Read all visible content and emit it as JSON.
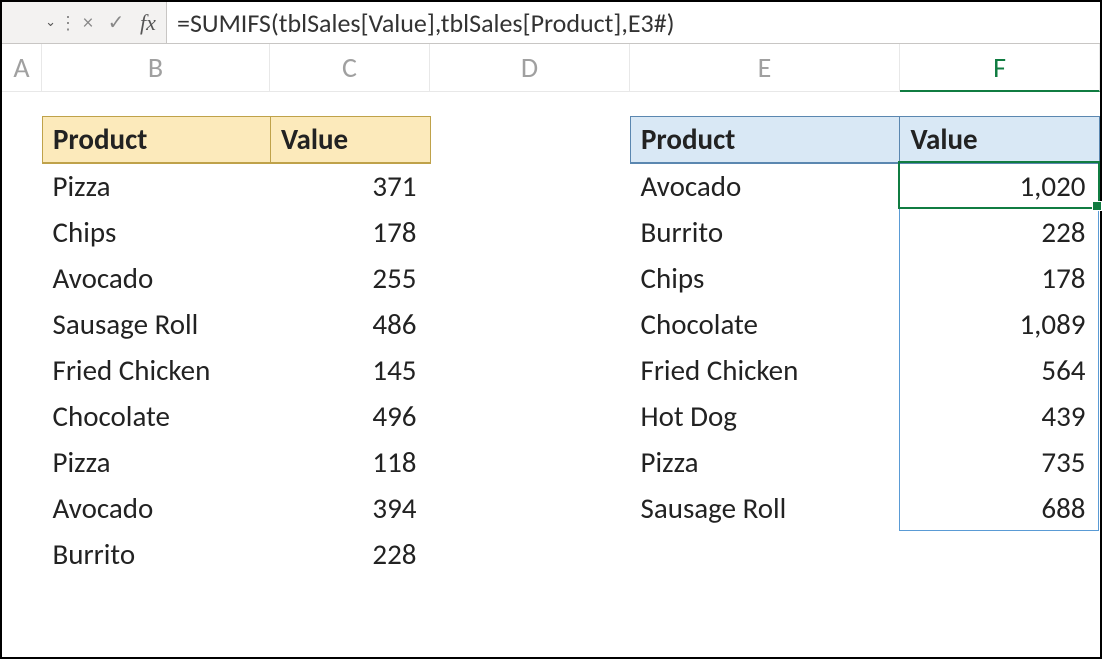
{
  "formula_bar": {
    "formula": "=SUMIFS(tblSales[Value],tblSales[Product],E3#)",
    "fx_label": "fx",
    "cancel_symbol": "×",
    "enter_symbol": "✓",
    "dropdown_symbol": "⌄",
    "separator": "⋮"
  },
  "columns": {
    "A": "A",
    "B": "B",
    "C": "C",
    "D": "D",
    "E": "E",
    "F": "F"
  },
  "table1": {
    "headers": {
      "product": "Product",
      "value": "Value"
    },
    "rows": [
      {
        "product": "Pizza",
        "value": "371"
      },
      {
        "product": "Chips",
        "value": "178"
      },
      {
        "product": "Avocado",
        "value": "255"
      },
      {
        "product": "Sausage Roll",
        "value": "486"
      },
      {
        "product": "Fried Chicken",
        "value": "145"
      },
      {
        "product": "Chocolate",
        "value": "496"
      },
      {
        "product": "Pizza",
        "value": "118"
      },
      {
        "product": "Avocado",
        "value": "394"
      },
      {
        "product": "Burrito",
        "value": "228"
      }
    ]
  },
  "table2": {
    "headers": {
      "product": "Product",
      "value": "Value"
    },
    "rows": [
      {
        "product": "Avocado",
        "value": "1,020"
      },
      {
        "product": "Burrito",
        "value": "228"
      },
      {
        "product": "Chips",
        "value": "178"
      },
      {
        "product": "Chocolate",
        "value": "1,089"
      },
      {
        "product": "Fried Chicken",
        "value": "564"
      },
      {
        "product": "Hot Dog",
        "value": "439"
      },
      {
        "product": "Pizza",
        "value": "735"
      },
      {
        "product": "Sausage Roll",
        "value": "688"
      }
    ]
  }
}
